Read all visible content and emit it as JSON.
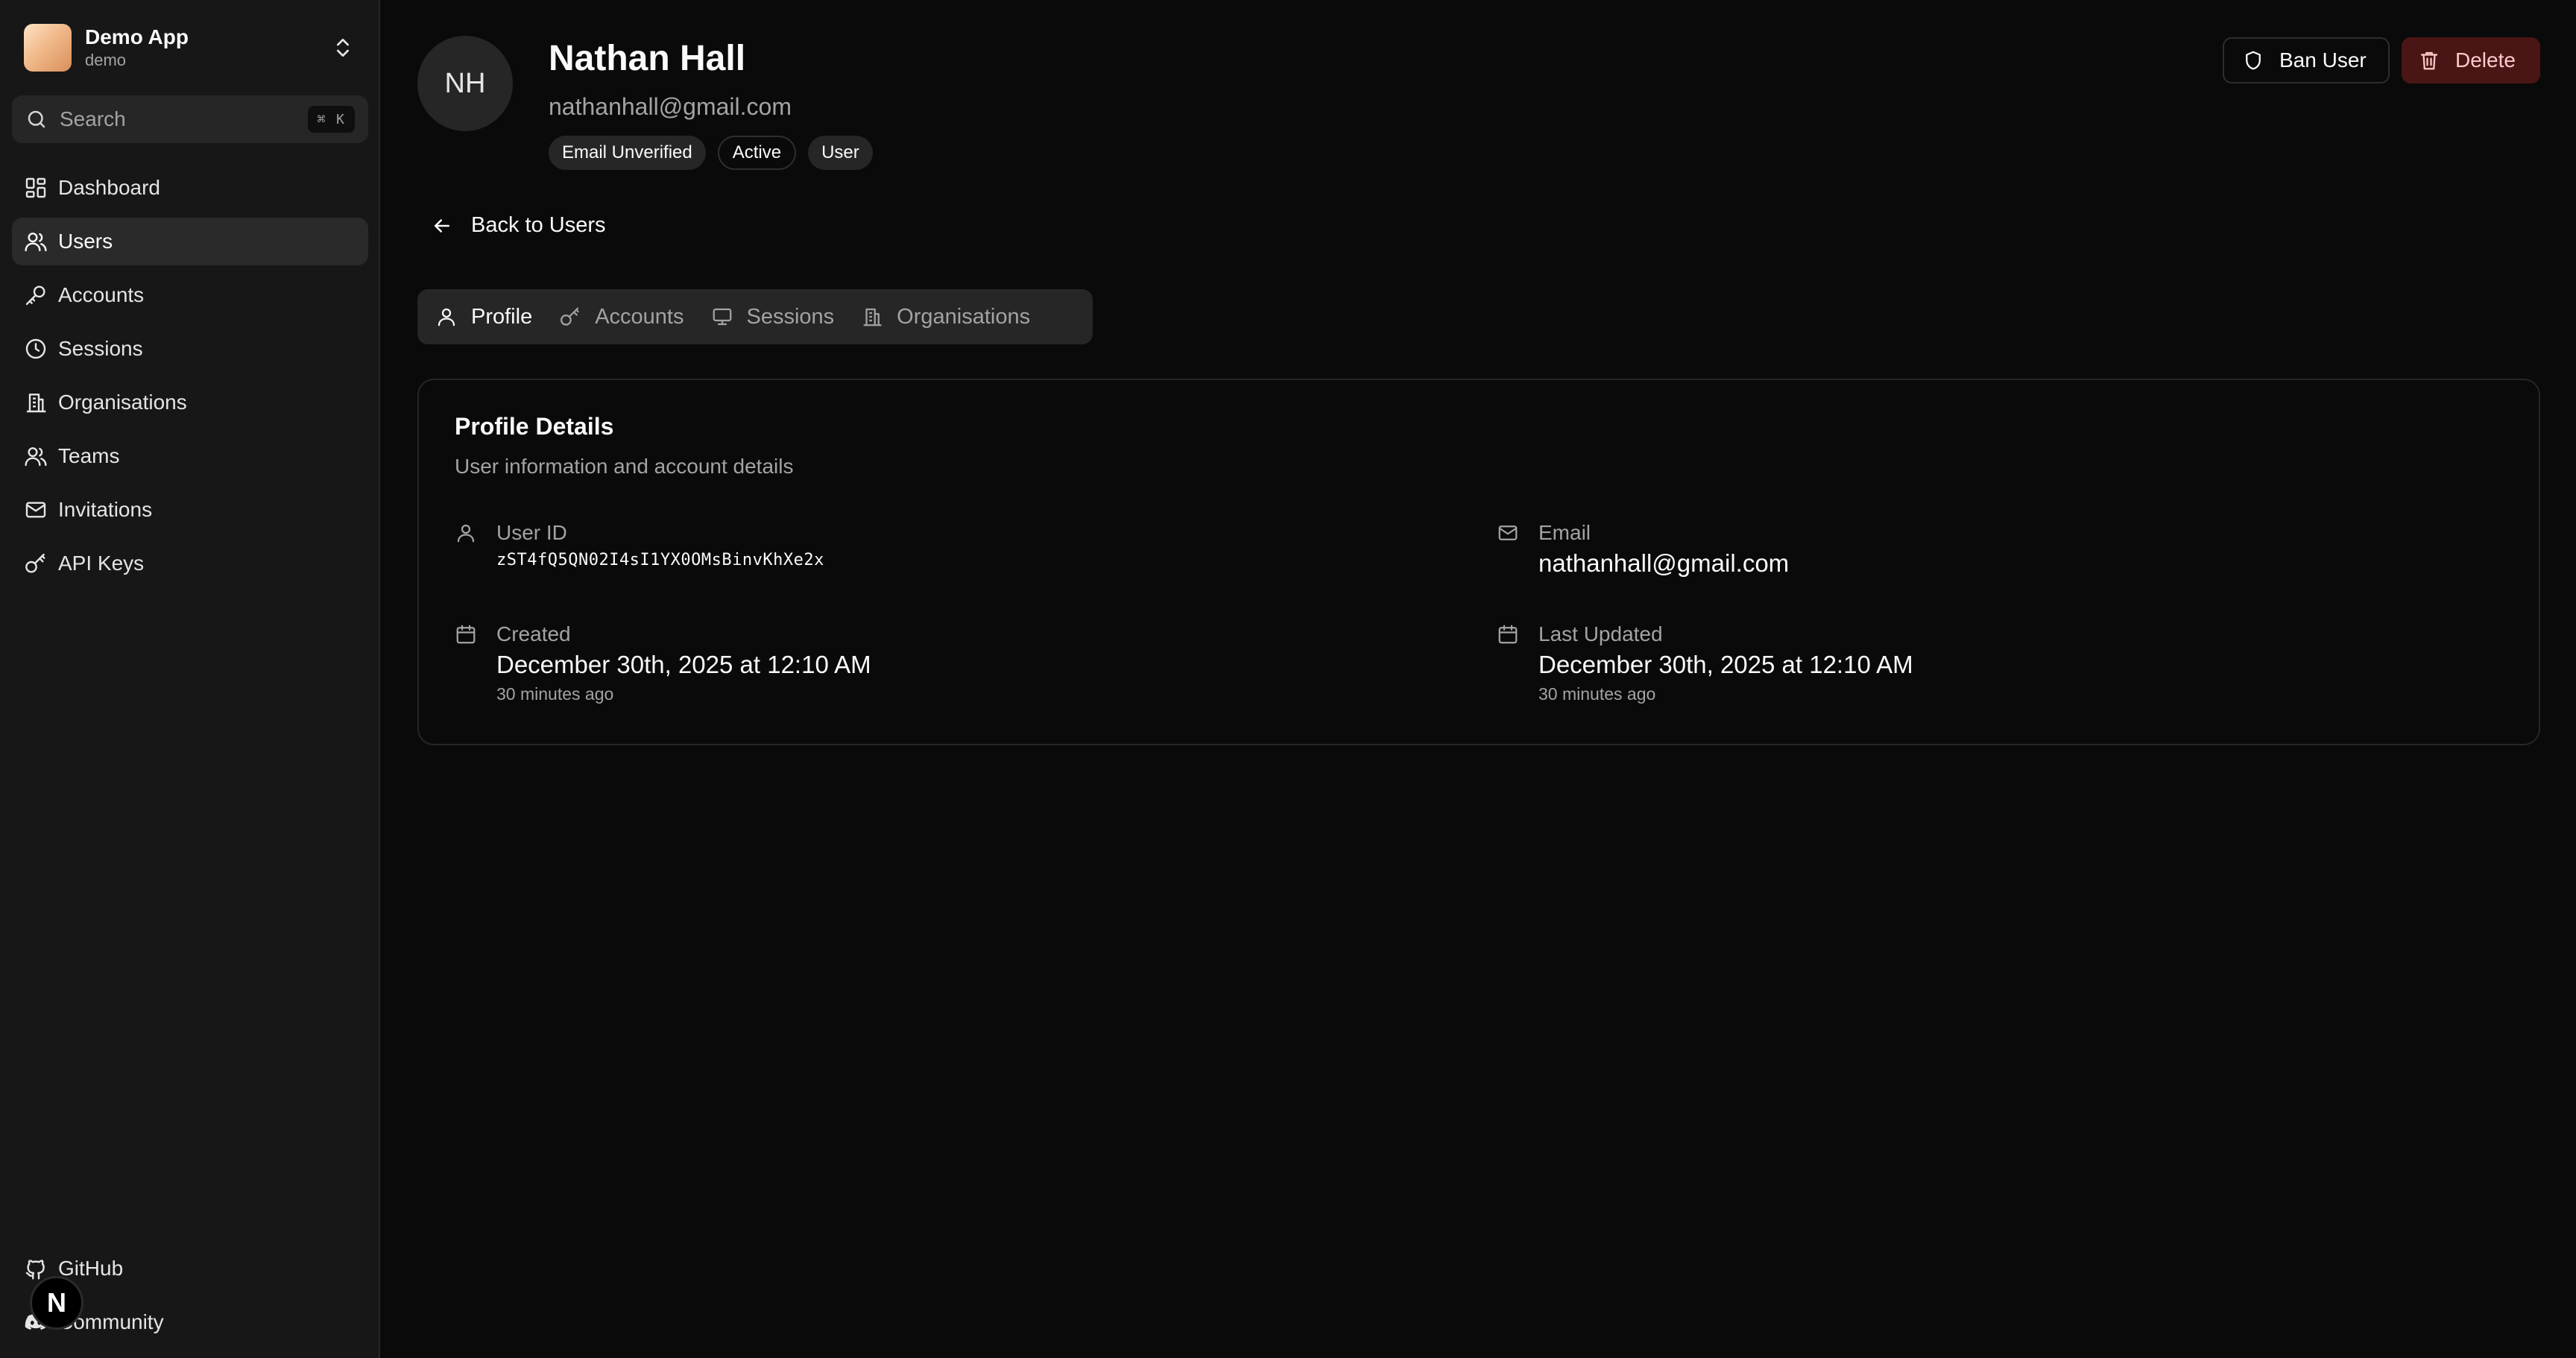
{
  "app": {
    "name": "Demo App",
    "subtitle": "demo"
  },
  "search": {
    "label": "Search",
    "shortcut": "⌘ K"
  },
  "nav": {
    "items": [
      {
        "label": "Dashboard",
        "icon": "dashboard-icon"
      },
      {
        "label": "Users",
        "icon": "users-icon",
        "active": true
      },
      {
        "label": "Accounts",
        "icon": "key-icon"
      },
      {
        "label": "Sessions",
        "icon": "clock-icon"
      },
      {
        "label": "Organisations",
        "icon": "building-icon"
      },
      {
        "label": "Teams",
        "icon": "team-icon"
      },
      {
        "label": "Invitations",
        "icon": "mail-icon"
      },
      {
        "label": "API Keys",
        "icon": "key-round-icon"
      }
    ],
    "bottom": [
      {
        "label": "GitHub",
        "icon": "github-icon"
      },
      {
        "label": "Community",
        "icon": "discord-icon"
      }
    ]
  },
  "overlay_badge": "N",
  "user": {
    "initials": "NH",
    "name": "Nathan Hall",
    "email": "nathanhall@gmail.com",
    "badges": [
      "Email Unverified",
      "Active",
      "User"
    ]
  },
  "actions": {
    "ban": "Ban User",
    "delete": "Delete"
  },
  "back": "Back to Users",
  "tabs": [
    {
      "label": "Profile",
      "icon": "user-icon",
      "active": true
    },
    {
      "label": "Accounts",
      "icon": "key-round-icon"
    },
    {
      "label": "Sessions",
      "icon": "monitor-icon"
    },
    {
      "label": "Organisations",
      "icon": "building-icon"
    }
  ],
  "profile": {
    "title": "Profile Details",
    "description": "User information and account details",
    "user_id_label": "User ID",
    "user_id": "zST4fQ5QN02I4sI1YX0OMsBinvKhXe2x",
    "email_label": "Email",
    "email": "nathanhall@gmail.com",
    "created_label": "Created",
    "created": "December 30th, 2025 at 12:10 AM",
    "created_ago": "30 minutes ago",
    "updated_label": "Last Updated",
    "updated": "December 30th, 2025 at 12:10 AM",
    "updated_ago": "30 minutes ago"
  },
  "colors": {
    "background": "#0a0a0a",
    "sidebar": "#171717",
    "muted_text": "#a3a3a3",
    "danger_bg": "#4a1515",
    "danger_text": "#fecaca"
  }
}
